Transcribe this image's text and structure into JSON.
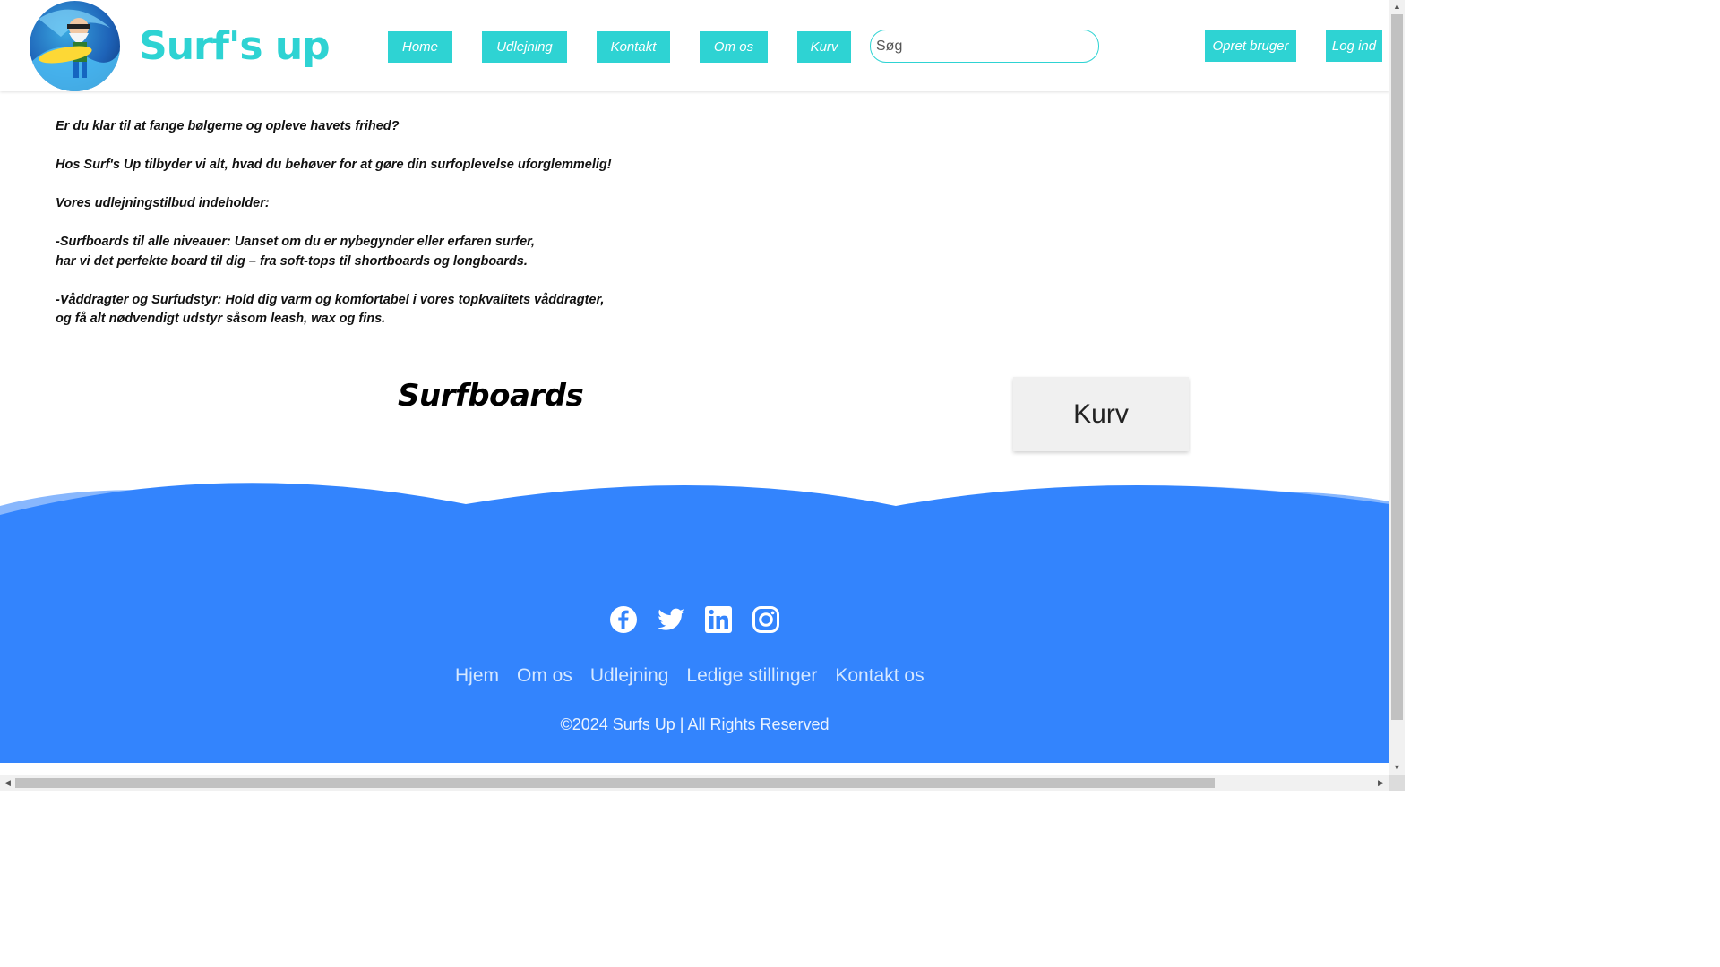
{
  "header": {
    "brand": "Surf's up",
    "nav": [
      {
        "label": "Home"
      },
      {
        "label": "Udlejning"
      },
      {
        "label": "Kontakt"
      },
      {
        "label": "Om os"
      },
      {
        "label": "Kurv"
      }
    ],
    "search_placeholder": "Søg",
    "create_user_label": "Opret bruger",
    "login_label": "Log ind",
    "accent_color": "#2ed3d3"
  },
  "intro": {
    "line1": "Er du klar til at fange bølgerne og opleve havets frihed?",
    "line2": "Hos Surf's Up tilbyder vi alt, hvad du behøver for at gøre din surfoplevelse uforglemmelig!",
    "line3": "Vores udlejningstilbud indeholder:",
    "boards_a": "-Surfboards til alle niveauer: Uanset om du er nybegynder eller erfaren surfer,",
    "boards_b": "har vi det perfekte board til dig – fra soft-tops til shortboards og longboards.",
    "suits_a": "-Våddragter og Surfudstyr: Hold dig varm og komfortabel i vores topkvalitets våddragter,",
    "suits_b": "og få alt nødvendigt udstyr såsom leash, wax og fins."
  },
  "main": {
    "section_title": "Surfboards",
    "cart_title": "Kurv"
  },
  "footer": {
    "social_icons": [
      "facebook-icon",
      "twitter-icon",
      "linkedin-icon",
      "instagram-icon"
    ],
    "links": [
      "Hjem",
      "Om os",
      "Udlejning",
      "Ledige stillinger",
      "Kontakt os"
    ],
    "copyright": "©2024 Surfs Up | All Rights Reserved",
    "background_color": "#3384fd"
  }
}
